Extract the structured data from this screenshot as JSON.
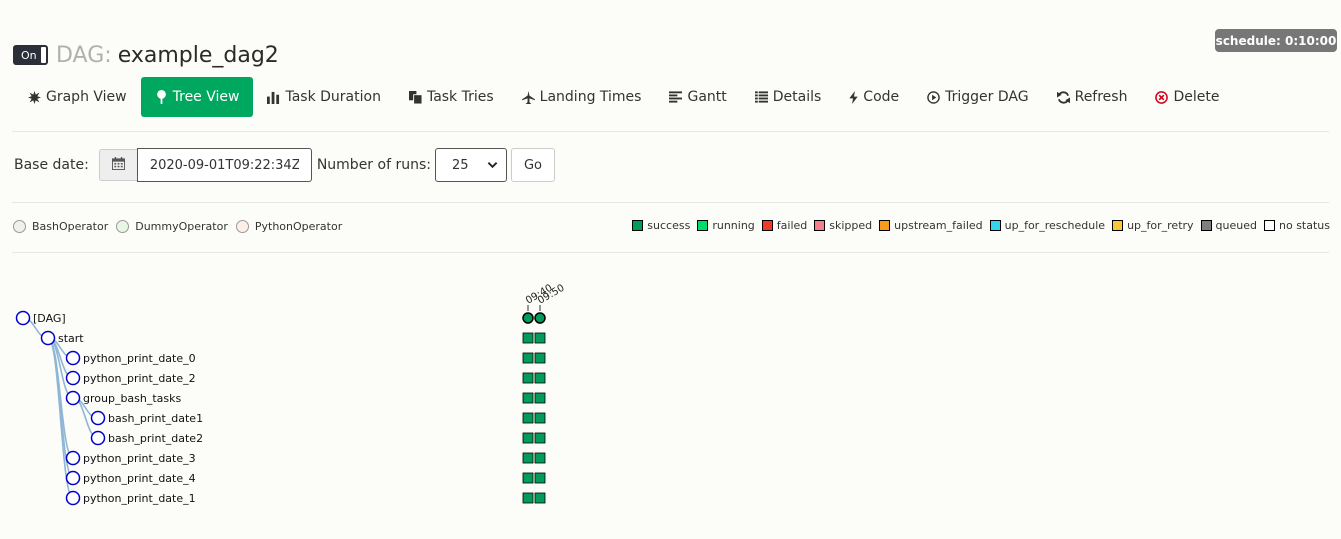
{
  "header": {
    "toggle_label": "On",
    "dag_prefix": "DAG:",
    "dag_name": "example_dag2",
    "schedule": "schedule: 0:10:00"
  },
  "nav": {
    "items": [
      {
        "label": "Graph View",
        "icon": "burst-icon"
      },
      {
        "label": "Tree View",
        "icon": "tree-icon",
        "active": true
      },
      {
        "label": "Task Duration",
        "icon": "bar-chart-icon"
      },
      {
        "label": "Task Tries",
        "icon": "copy-icon"
      },
      {
        "label": "Landing Times",
        "icon": "plane-icon"
      },
      {
        "label": "Gantt",
        "icon": "align-left-icon"
      },
      {
        "label": "Details",
        "icon": "list-icon"
      },
      {
        "label": "Code",
        "icon": "bolt-icon"
      },
      {
        "label": "Trigger DAG",
        "icon": "play-circle-icon"
      },
      {
        "label": "Refresh",
        "icon": "refresh-icon"
      },
      {
        "label": "Delete",
        "icon": "delete-circle-icon"
      }
    ]
  },
  "controls": {
    "base_date_label": "Base date:",
    "base_date_value": "2020-09-01T09:22:34Z",
    "runs_label": "Number of runs:",
    "runs_value": "25",
    "go_label": "Go"
  },
  "operator_legend": [
    {
      "label": "BashOperator",
      "color": "#f0f0ef"
    },
    {
      "label": "DummyOperator",
      "color": "#e8f7e4"
    },
    {
      "label": "PythonOperator",
      "color": "#ffefeb"
    }
  ],
  "state_legend": [
    {
      "label": "success",
      "color": "#019c5a"
    },
    {
      "label": "running",
      "color": "#01dd6a"
    },
    {
      "label": "failed",
      "color": "#ee3a26"
    },
    {
      "label": "skipped",
      "color": "#f57f8e"
    },
    {
      "label": "upstream_failed",
      "color": "#f89920"
    },
    {
      "label": "up_for_reschedule",
      "color": "#34d4f1"
    },
    {
      "label": "up_for_retry",
      "color": "#f7c73c"
    },
    {
      "label": "queued",
      "color": "#7f7f7f"
    },
    {
      "label": "no status",
      "color": "#ffffff"
    }
  ],
  "tree": {
    "run_labels": [
      "09:40",
      "09:50"
    ],
    "nodes": [
      {
        "label": "[DAG]",
        "depth": 0,
        "parent": null
      },
      {
        "label": "start",
        "depth": 1,
        "parent": 0
      },
      {
        "label": "python_print_date_0",
        "depth": 2,
        "parent": 1
      },
      {
        "label": "python_print_date_2",
        "depth": 2,
        "parent": 1
      },
      {
        "label": "group_bash_tasks",
        "depth": 2,
        "parent": 1
      },
      {
        "label": "bash_print_date1",
        "depth": 3,
        "parent": 4
      },
      {
        "label": "bash_print_date2",
        "depth": 3,
        "parent": 4
      },
      {
        "label": "python_print_date_3",
        "depth": 2,
        "parent": 1
      },
      {
        "label": "python_print_date_4",
        "depth": 2,
        "parent": 1
      },
      {
        "label": "python_print_date_1",
        "depth": 2,
        "parent": 1
      }
    ],
    "run_state_color": "#019c5a"
  }
}
